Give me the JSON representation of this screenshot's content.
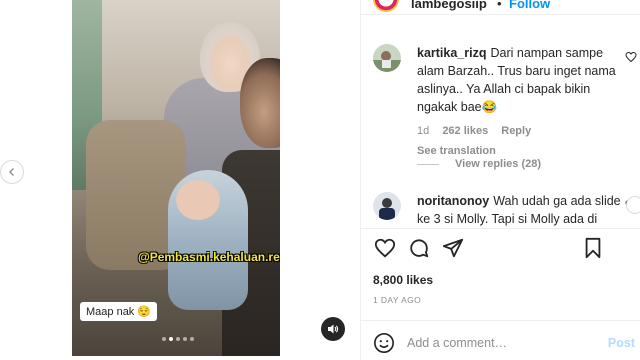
{
  "post": {
    "username": "lambegosiip",
    "separator": "•",
    "follow_label": "Follow",
    "media": {
      "watermark": "@Pembasmi.kehaluan.reall",
      "caption": "Maap nak 😌",
      "slides": 5,
      "active_slide": 2
    },
    "comments": [
      {
        "username": "kartika_rizq",
        "text": "Dari nampan sampe alam Barzah.. Trus baru inget nama aslinya.. Ya Allah ci bapak bikin ngakak bae😂",
        "time": "1d",
        "likes": "262 likes",
        "reply": "Reply",
        "see_translation": "See translation",
        "view_replies": "View replies (28)"
      },
      {
        "username": "noritanonoy",
        "text": "Wah udah ga ada slide ke 3 si Molly. Tapi si Molly ada di"
      }
    ],
    "likes_count": "8,800 likes",
    "date": "1 DAY AGO",
    "add_comment_placeholder": "Add a comment…",
    "post_label": "Post"
  },
  "colors": {
    "accent": "#0095f6",
    "watermark": "#f2e53b",
    "post_disabled": "#b3dbff"
  }
}
